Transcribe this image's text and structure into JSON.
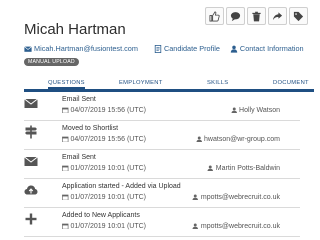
{
  "toolbar": {
    "buttons": [
      {
        "icon": "thumbs-up-icon"
      },
      {
        "icon": "comment-icon"
      },
      {
        "icon": "trash-icon"
      },
      {
        "icon": "share-icon"
      },
      {
        "icon": "tag-icon"
      }
    ]
  },
  "candidate": {
    "name": "Micah Hartman",
    "email": "Micah.Hartman@fusiontest.com",
    "profile_link": "Candidate Profile",
    "contact_link": "Contact Information",
    "badge": "MANUAL UPLOAD"
  },
  "tabs": [
    {
      "label": "QUESTIONS",
      "active": true
    },
    {
      "label": "EMPLOYMENT",
      "active": false
    },
    {
      "label": "SKILLS",
      "active": false
    },
    {
      "label": "DOCUMENT",
      "active": false
    }
  ],
  "events": [
    {
      "icon": "envelope-icon",
      "title": "Email Sent",
      "date": "04/07/2019 15:56 (UTC)",
      "user": "Holly Watson"
    },
    {
      "icon": "signpost-icon",
      "title": "Moved to Shortlist",
      "date": "04/07/2019 15:56 (UTC)",
      "user": "hwatson@wr-group.com"
    },
    {
      "icon": "envelope-icon",
      "title": "Email Sent",
      "date": "01/07/2019 10:01 (UTC)",
      "user": "Martin Potts-Baldwin"
    },
    {
      "icon": "cloud-upload-icon",
      "title": "Application started - Added via Upload",
      "date": "01/07/2019 10:01 (UTC)",
      "user": "mpotts@webrecruit.co.uk"
    },
    {
      "icon": "plus-icon",
      "title": "Added to New Applicants",
      "date": "01/07/2019 10:01 (UTC)",
      "user": "mpotts@webrecruit.co.uk"
    }
  ]
}
